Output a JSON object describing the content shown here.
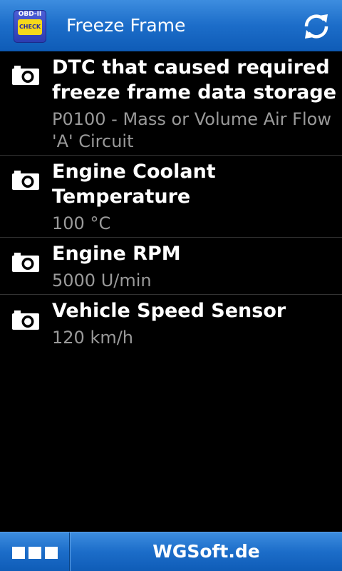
{
  "header": {
    "app_icon": {
      "top_text": "OBD-II",
      "badge_text": "CHECK",
      "badge_color": "#f6d81a",
      "icon": "engine-check-icon"
    },
    "title": "Freeze Frame",
    "refresh_icon": "refresh-icon"
  },
  "items": [
    {
      "icon": "camera-icon",
      "title": "DTC that caused required\nfreeze frame data storage",
      "value": "P0100 - Mass or Volume Air Flow\n'A' Circuit"
    },
    {
      "icon": "camera-icon",
      "title": "Engine Coolant\nTemperature",
      "value": "100 °C"
    },
    {
      "icon": "camera-icon",
      "title": "Engine RPM",
      "value": "5000 U/min"
    },
    {
      "icon": "camera-icon",
      "title": "Vehicle Speed Sensor",
      "value": "120 km/h"
    }
  ],
  "footer": {
    "menu_icon": "grid-menu-icon",
    "brand": "WGSoft.de"
  },
  "colors": {
    "bar_blue": "#1c6dc9",
    "background": "#000000",
    "title_text": "#ffffff",
    "value_text": "#9a9a9a",
    "divider": "#333333"
  }
}
